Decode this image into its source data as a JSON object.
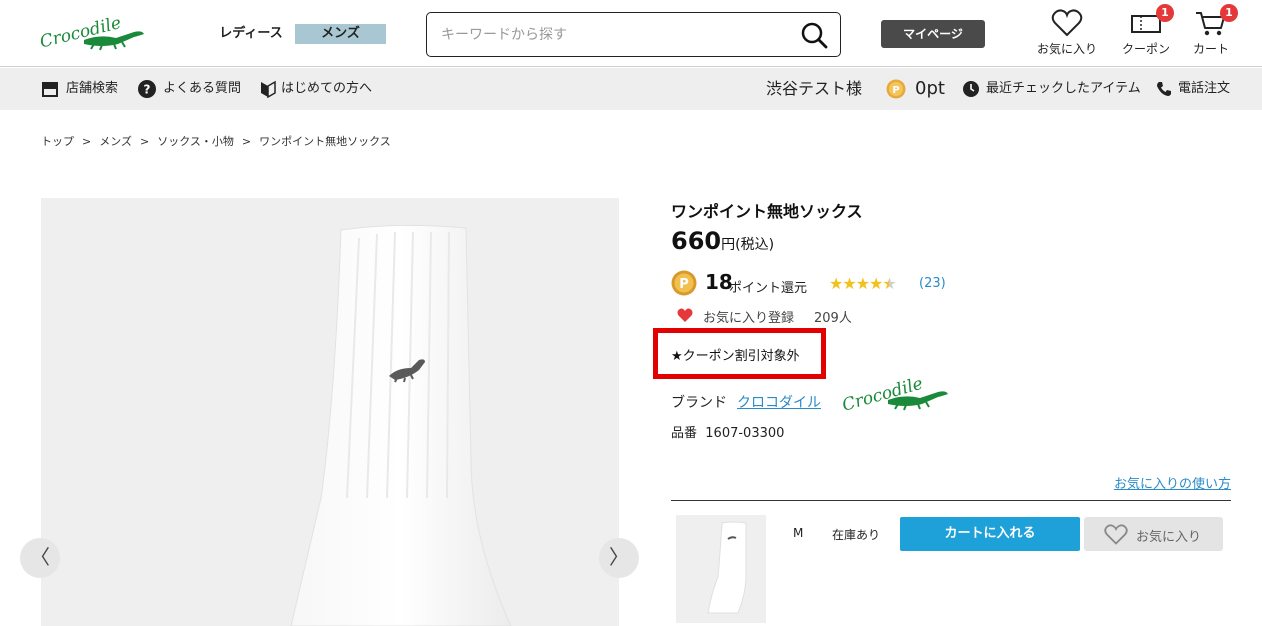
{
  "header": {
    "brand_logo_text": "Crocodile",
    "gender_ladies": "レディース",
    "gender_mens": "メンズ",
    "search_placeholder": "キーワードから探す",
    "mypage_label": "マイページ",
    "favorites_label": "お気に入り",
    "coupon_label": "クーポン",
    "coupon_badge": "1",
    "cart_label": "カート",
    "cart_badge": "1"
  },
  "subnav": {
    "store_search": "店舗検索",
    "faq": "よくある質問",
    "first_time": "はじめての方へ",
    "user_name": "渋谷テスト様",
    "points": "0pt",
    "recent_items": "最近チェックしたアイテム",
    "phone_order": "電話注文"
  },
  "breadcrumb": {
    "items": [
      "トップ",
      "メンズ",
      "ソックス・小物",
      "ワンポイント無地ソックス"
    ],
    "separator": ">"
  },
  "product": {
    "title": "ワンポイント無地ソックス",
    "price": "660",
    "price_unit": "円(税込)",
    "points_value": "18",
    "points_label": "ポイント還元",
    "rating": 4.5,
    "review_count": "(23)",
    "favorite_label": "お気に入り登録",
    "favorite_count": "209人",
    "coupon_notice": "★クーポン割引対象外",
    "brand_label": "ブランド",
    "brand_name": "クロコダイル",
    "sku_label": "品番",
    "sku_value": "1607-03300",
    "favorite_howto": "お気に入りの使い方"
  },
  "variant": {
    "size": "M",
    "stock": "在庫あり",
    "add_to_cart": "カートに入れる",
    "add_favorite": "お気に入り"
  },
  "gallery": {
    "prev_arrow": "〈",
    "next_arrow": "〉"
  },
  "colors": {
    "accent_blue": "#1da1d8",
    "link_blue": "#2a8bc8",
    "highlight_red": "#e30000",
    "badge_red": "#e5383b",
    "mens_tab": "#a9c7d2",
    "brand_green": "#1a8a3a",
    "star_gold": "#f2c21b"
  }
}
